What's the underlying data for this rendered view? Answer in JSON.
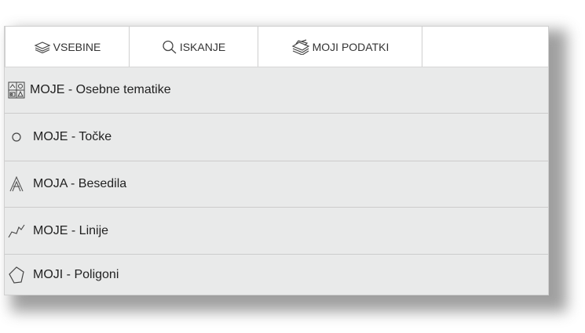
{
  "tabs": [
    {
      "label": "VSEBINE",
      "icon": "layers-icon"
    },
    {
      "label": "ISKANJE",
      "icon": "search-icon"
    },
    {
      "label": "MOJI PODATKI",
      "icon": "stacked-layers-icon"
    }
  ],
  "layers": [
    {
      "label": "MOJE - Osebne tematike",
      "icon": "thematic-map-icon"
    },
    {
      "label": "MOJE - Točke",
      "icon": "point-icon"
    },
    {
      "label": "MOJA - Besedila",
      "icon": "text-icon"
    },
    {
      "label": "MOJE - Linije",
      "icon": "polyline-icon"
    },
    {
      "label": "MOJI - Poligoni",
      "icon": "polygon-icon"
    }
  ]
}
